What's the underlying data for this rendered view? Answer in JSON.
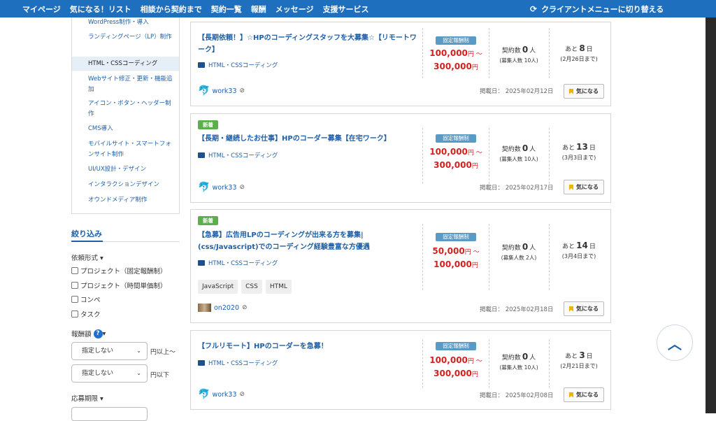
{
  "nav": {
    "items": [
      "マイページ",
      "気になる！リスト",
      "相談から契約まで",
      "契約一覧",
      "報酬",
      "メッセージ",
      "支援サービス"
    ],
    "switch_label": "クライアントメニューに切り替える"
  },
  "categories": [
    "WordPress制作・導入",
    "ランディングページ（LP）制作",
    "HTML・CSSコーディング",
    "Webサイト修正・更新・機能追加",
    "アイコン・ボタン・ヘッダー制作",
    "CMS導入",
    "モバイルサイト・スマートフォンサイト制作",
    "UI/UX設計・デザイン",
    "インタラクションデザイン",
    "オウンドメディア制作"
  ],
  "filter": {
    "title": "絞り込み",
    "type_label": "依頼形式",
    "options": [
      "プロジェクト（固定報酬制）",
      "プロジェクト（時間単価制）",
      "コンペ",
      "タスク"
    ],
    "reward_label": "報酬額",
    "select_min": "指定しない",
    "select_min_suffix": "円以上〜",
    "select_max": "指定しない",
    "select_max_suffix": "円以下",
    "deadline_label": "応募期限"
  },
  "jobs": [
    {
      "is_new": false,
      "title": "【長期依頼！】☆HPのコーディングスタッフを大募集☆【リモートワーク】",
      "category": "HTML・CSSコーディング",
      "tags": [],
      "user": "work33",
      "price_label": "固定報酬制",
      "price_min": "100,000",
      "price_max": "300,000",
      "contracts": "0",
      "recruit": "(募集人数 10人)",
      "remain_days": "8",
      "deadline": "(2月26日まで)",
      "posted": "掲載日： 2025年02月12日"
    },
    {
      "is_new": true,
      "title": "【長期・継続したお仕事】HPのコーダー募集【在宅ワーク】",
      "category": "HTML・CSSコーディング",
      "tags": [],
      "user": "work33",
      "price_label": "固定報酬制",
      "price_min": "100,000",
      "price_max": "300,000",
      "contracts": "0",
      "recruit": "(募集人数 10人)",
      "remain_days": "13",
      "deadline": "(3月3日まで)",
      "posted": "掲載日： 2025年02月17日"
    },
    {
      "is_new": true,
      "title": "【急募】広告用LPのコーディングが出来る方を募集|(css/Javascript)でのコーディング経験豊富な方優遇",
      "category": "HTML・CSSコーディング",
      "tags": [
        "JavaScript",
        "CSS",
        "HTML"
      ],
      "user": "on2020",
      "price_label": "固定報酬制",
      "price_min": "50,000",
      "price_max": "100,000",
      "contracts": "0",
      "recruit": "(募集人数 2人)",
      "remain_days": "14",
      "deadline": "(3月4日まで)",
      "posted": "掲載日： 2025年02月18日"
    },
    {
      "is_new": false,
      "title": "【フルリモート】HPのコーダーを急募！",
      "category": "HTML・CSSコーディング",
      "tags": [],
      "user": "work33",
      "price_label": "固定報酬制",
      "price_min": "100,000",
      "price_max": "300,000",
      "contracts": "0",
      "recruit": "(募集人数 10人)",
      "remain_days": "3",
      "deadline": "(2月21日まで)",
      "posted": "掲載日： 2025年02月08日"
    }
  ],
  "labels": {
    "new": "新着",
    "yen_tilde": "円 〜",
    "yen": "円",
    "contracts_prefix": "契約数",
    "contracts_suffix": "人",
    "remain_prefix": "あと",
    "remain_suffix": "日",
    "favorite": "気になる"
  }
}
